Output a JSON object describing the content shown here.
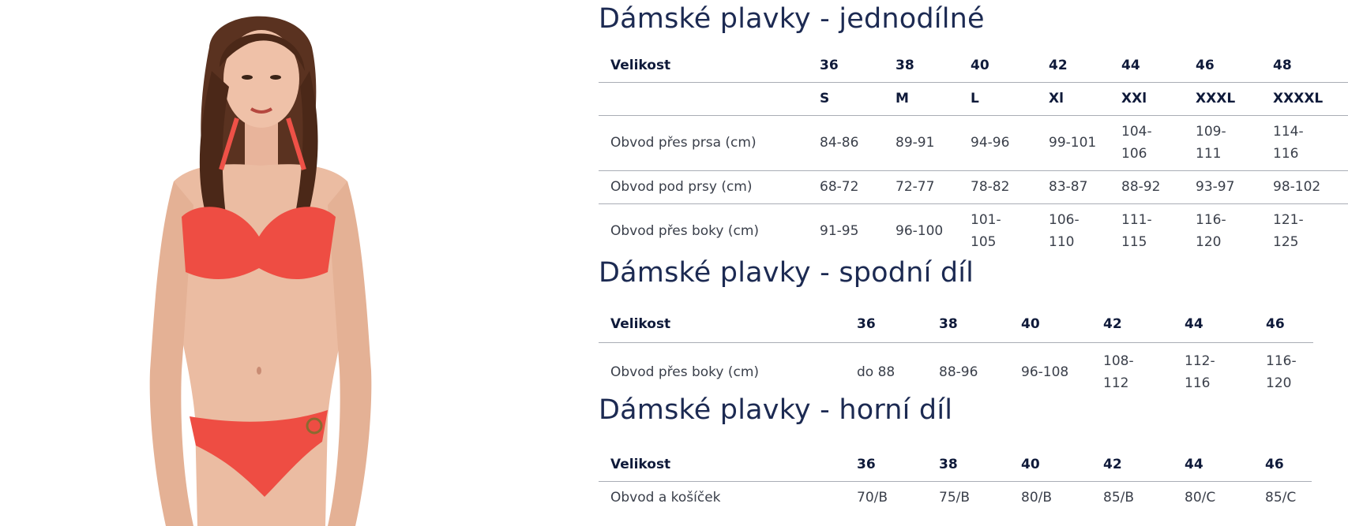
{
  "product_photo": {
    "description_icon": "model-photo"
  },
  "sections": [
    {
      "title": "Dámské plavky - jednodílné",
      "header": {
        "label": "Velikost",
        "values": [
          "36",
          "38",
          "40",
          "42",
          "44",
          "46",
          "48"
        ]
      },
      "letter_row": {
        "label": "",
        "values": [
          "S",
          "M",
          "L",
          "Xl",
          "XXl",
          "XXXL",
          "XXXXL"
        ]
      },
      "rows": [
        {
          "label": "Obvod přes prsa (cm)",
          "values": [
            "84-86",
            "89-91",
            "94-96",
            "99-101",
            "104-106",
            "109-111",
            "114-116"
          ]
        },
        {
          "label": "Obvod pod prsy (cm)",
          "values": [
            "68-72",
            "72-77",
            "78-82",
            "83-87",
            "88-92",
            "93-97",
            "98-102"
          ]
        },
        {
          "label": "Obvod přes boky (cm)",
          "values": [
            "91-95",
            "96-100",
            "101-105",
            "106-110",
            "111-115",
            "116-120",
            "121-125"
          ]
        }
      ]
    },
    {
      "title": "Dámské plavky - spodní díl",
      "header": {
        "label": "Velikost",
        "values": [
          "36",
          "38",
          "40",
          "42",
          "44",
          "46"
        ]
      },
      "rows": [
        {
          "label": "Obvod přes boky (cm)",
          "values": [
            "do 88",
            "88-96",
            "96-108",
            "108-112",
            "112-116",
            "116-120"
          ]
        }
      ]
    },
    {
      "title": "Dámské plavky - horní díl",
      "header": {
        "label": "Velikost",
        "values": [
          "36",
          "38",
          "40",
          "42",
          "44",
          "46"
        ]
      },
      "rows": [
        {
          "label": "Obvod a košíček",
          "values": [
            "70/B",
            "75/B",
            "80/B",
            "85/B",
            "80/C",
            "85/C"
          ]
        }
      ]
    }
  ]
}
